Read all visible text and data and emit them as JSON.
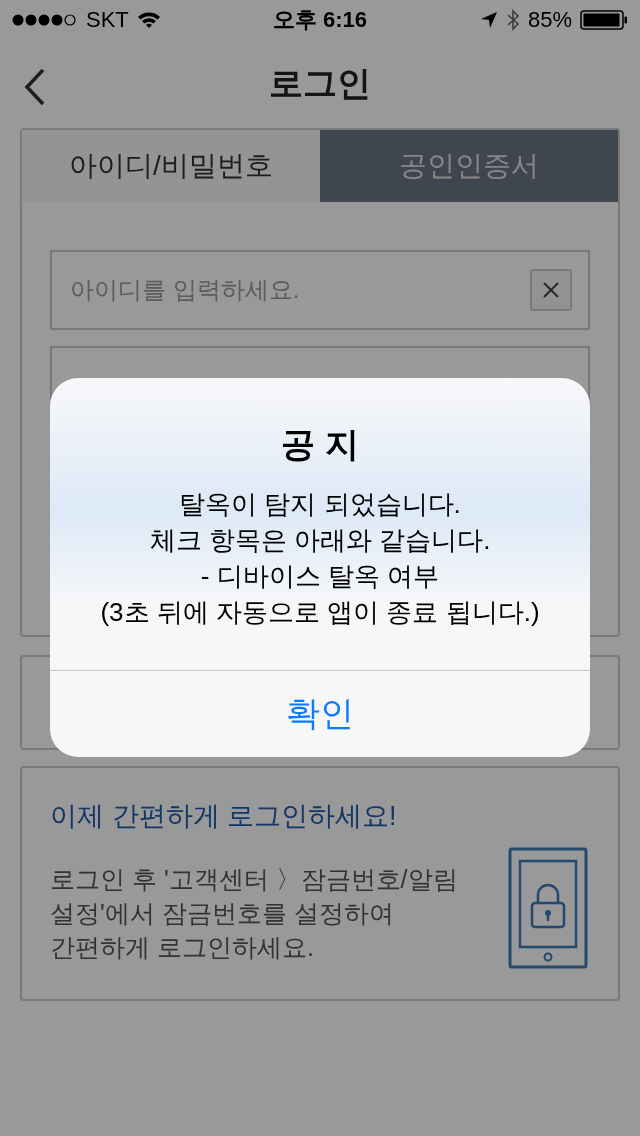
{
  "status_bar": {
    "carrier": "SKT",
    "time": "오후 6:16",
    "battery": "85%"
  },
  "nav": {
    "title": "로그인"
  },
  "tabs": [
    {
      "label": "아이디/비밀번호",
      "selected": true
    },
    {
      "label": "공인인증서",
      "selected": false
    }
  ],
  "id_field": {
    "placeholder": "아이디를 입력하세요."
  },
  "promo": {
    "title": "이제 간편하게 로그인하세요!",
    "text": "로그인 후 '고객센터 〉잠금번호/알림\n설정'에서 잠금번호를 설정하여\n간편하게 로그인하세요."
  },
  "dialog": {
    "title": "공 지",
    "message": "탈옥이 탐지 되었습니다.\n체크 항목은 아래와 같습니다.\n- 디바이스 탈옥 여부\n(3초 뒤에 자동으로 앱이 종료 됩니다.)",
    "button": "확인"
  }
}
